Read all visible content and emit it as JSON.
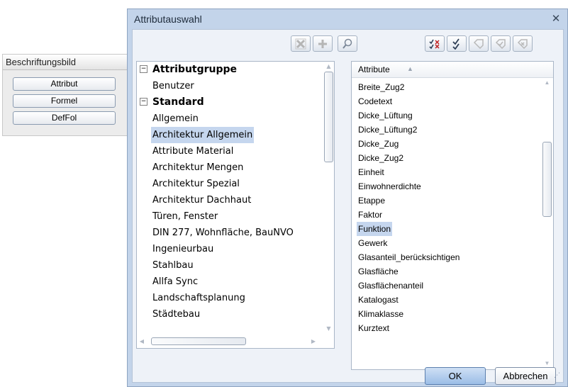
{
  "palette": {
    "title": "Beschriftungsbild",
    "buttons": [
      "Attribut",
      "Formel",
      "DefFol"
    ]
  },
  "dialog": {
    "title": "Attributauswahl",
    "close_icon": "close-icon",
    "toolbar_icons": [
      "delete-icon",
      "add-icon",
      "search-icon",
      "check-all-icon",
      "check-icon",
      "tag-icon",
      "tag-check-icon",
      "tag-cross-icon"
    ],
    "groups": [
      {
        "label": "Attributgruppe",
        "items": [
          "Benutzer"
        ]
      },
      {
        "label": "Standard",
        "items": [
          "Allgemein",
          "Architektur Allgemein",
          "Attribute Material",
          "Architektur Mengen",
          "Architektur Spezial",
          "Architektur Dachhaut",
          "Türen, Fenster",
          "DIN 277, Wohnfläche, BauNVO",
          "Ingenieurbau",
          "Stahlbau",
          "Allfa Sync",
          "Landschaftsplanung",
          "Städtebau"
        ]
      }
    ],
    "selected_group": "Architektur Allgemein",
    "attributes_header": "Attribute",
    "attributes": [
      "Breite_Zug2",
      "Codetext",
      "Dicke_Lüftung",
      "Dicke_Lüftung2",
      "Dicke_Zug",
      "Dicke_Zug2",
      "Einheit",
      "Einwohnerdichte",
      "Etappe",
      "Faktor",
      "Funktion",
      "Gewerk",
      "Glasanteil_berücksichtigen",
      "Glasfläche",
      "Glasflächenanteil",
      "Katalogast",
      "Klimaklasse",
      "Kurztext"
    ],
    "selected_attribute": "Funktion",
    "ok_label": "OK",
    "cancel_label": "Abbrechen",
    "colors": {
      "selection": "#c5d6ee",
      "frame": "#c3d4ea",
      "ok_button": "#9bbde6"
    }
  }
}
